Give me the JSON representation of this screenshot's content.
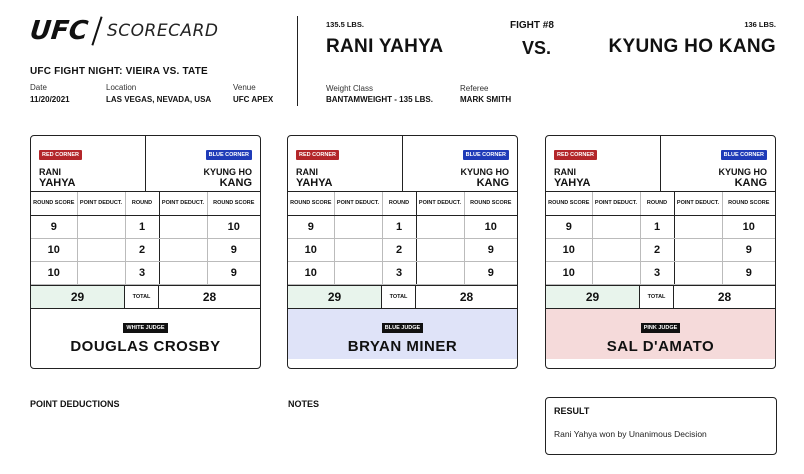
{
  "header": {
    "logo": "UFC",
    "title": "SCORECARD",
    "event": "UFC FIGHT NIGHT: VIEIRA VS. TATE",
    "date_label": "Date",
    "date": "11/20/2021",
    "location_label": "Location",
    "location": "LAS VEGAS, NEVADA, USA",
    "venue_label": "Venue",
    "venue": "UFC APEX"
  },
  "fight": {
    "weight_left": "135.5 LBS.",
    "fight_no": "FIGHT #8",
    "weight_right": "136 LBS.",
    "red_fighter": "RANI YAHYA",
    "vs": "VS.",
    "blue_fighter": "KYUNG HO KANG",
    "weight_class_label": "Weight Class",
    "weight_class": "BANTAMWEIGHT - 135 LBS.",
    "referee_label": "Referee",
    "referee": "MARK SMITH"
  },
  "card_labels": {
    "red_corner": "RED CORNER",
    "blue_corner": "BLUE CORNER",
    "red_first": "RANI",
    "red_last": "YAHYA",
    "blue_first": "KYUNG HO",
    "blue_last": "KANG",
    "round_score": "ROUND SCORE",
    "point_deduct": "POINT DEDUCT.",
    "round": "ROUND",
    "total": "TOTAL"
  },
  "cards": [
    {
      "judge_tag": "WHITE JUDGE",
      "judge": "DOUGLAS CROSBY",
      "rounds": [
        {
          "red": "9",
          "red_ded": "",
          "round": "1",
          "blue_ded": "",
          "blue": "10"
        },
        {
          "red": "10",
          "red_ded": "",
          "round": "2",
          "blue_ded": "",
          "blue": "9"
        },
        {
          "red": "10",
          "red_ded": "",
          "round": "3",
          "blue_ded": "",
          "blue": "9"
        }
      ],
      "total_red": "29",
      "total_blue": "28"
    },
    {
      "judge_tag": "BLUE JUDGE",
      "judge": "BRYAN MINER",
      "rounds": [
        {
          "red": "9",
          "red_ded": "",
          "round": "1",
          "blue_ded": "",
          "blue": "10"
        },
        {
          "red": "10",
          "red_ded": "",
          "round": "2",
          "blue_ded": "",
          "blue": "9"
        },
        {
          "red": "10",
          "red_ded": "",
          "round": "3",
          "blue_ded": "",
          "blue": "9"
        }
      ],
      "total_red": "29",
      "total_blue": "28"
    },
    {
      "judge_tag": "PINK JUDGE",
      "judge": "SAL D'AMATO",
      "rounds": [
        {
          "red": "9",
          "red_ded": "",
          "round": "1",
          "blue_ded": "",
          "blue": "10"
        },
        {
          "red": "10",
          "red_ded": "",
          "round": "2",
          "blue_ded": "",
          "blue": "9"
        },
        {
          "red": "10",
          "red_ded": "",
          "round": "3",
          "blue_ded": "",
          "blue": "9"
        }
      ],
      "total_red": "29",
      "total_blue": "28"
    }
  ],
  "footer": {
    "point_deductions": "POINT DEDUCTIONS",
    "notes": "NOTES",
    "result_title": "RESULT",
    "result_text": "Rani Yahya won by Unanimous Decision"
  },
  "colors": {
    "red_corner": "#b3262a",
    "blue_corner": "#1f3bb8",
    "total_bg": "#e8f4ec",
    "blue_judge_bg": "#dfe3f8",
    "pink_judge_bg": "#f5dada"
  }
}
